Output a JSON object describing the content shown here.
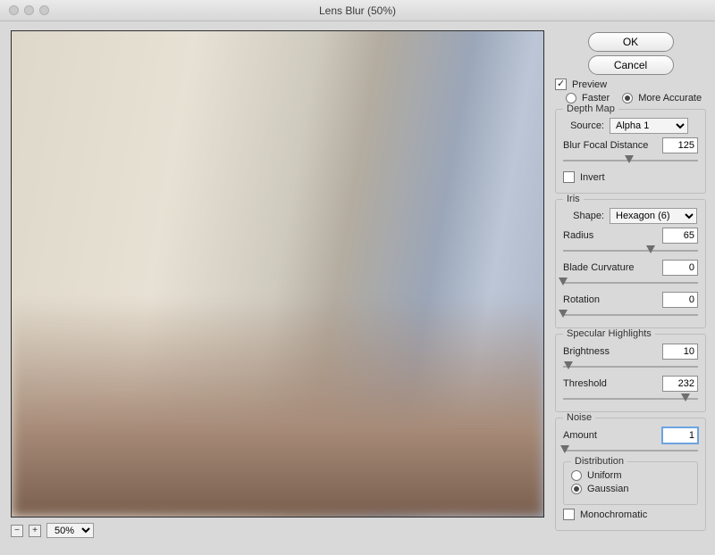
{
  "window": {
    "title": "Lens Blur (50%)"
  },
  "buttons": {
    "ok": "OK",
    "cancel": "Cancel"
  },
  "preview": {
    "checkbox_label": "Preview",
    "checked": true,
    "mode_faster": "Faster",
    "mode_accurate": "More Accurate",
    "mode_selected": "accurate"
  },
  "depth_map": {
    "group_title": "Depth Map",
    "source_label": "Source:",
    "source_value": "Alpha 1",
    "blur_focal_label": "Blur Focal Distance",
    "blur_focal_value": "125",
    "blur_focal_pct": 49,
    "invert_label": "Invert",
    "invert_checked": false
  },
  "iris": {
    "group_title": "Iris",
    "shape_label": "Shape:",
    "shape_value": "Hexagon (6)",
    "radius_label": "Radius",
    "radius_value": "65",
    "radius_pct": 65,
    "blade_label": "Blade Curvature",
    "blade_value": "0",
    "blade_pct": 0,
    "rotation_label": "Rotation",
    "rotation_value": "0",
    "rotation_pct": 0
  },
  "specular": {
    "group_title": "Specular Highlights",
    "brightness_label": "Brightness",
    "brightness_value": "10",
    "brightness_pct": 4,
    "threshold_label": "Threshold",
    "threshold_value": "232",
    "threshold_pct": 91
  },
  "noise": {
    "group_title": "Noise",
    "amount_label": "Amount",
    "amount_value": "1",
    "amount_pct": 1,
    "distribution_title": "Distribution",
    "uniform_label": "Uniform",
    "gaussian_label": "Gaussian",
    "distribution_selected": "gaussian",
    "mono_label": "Monochromatic",
    "mono_checked": false
  },
  "footer": {
    "zoom_value": "50%"
  }
}
